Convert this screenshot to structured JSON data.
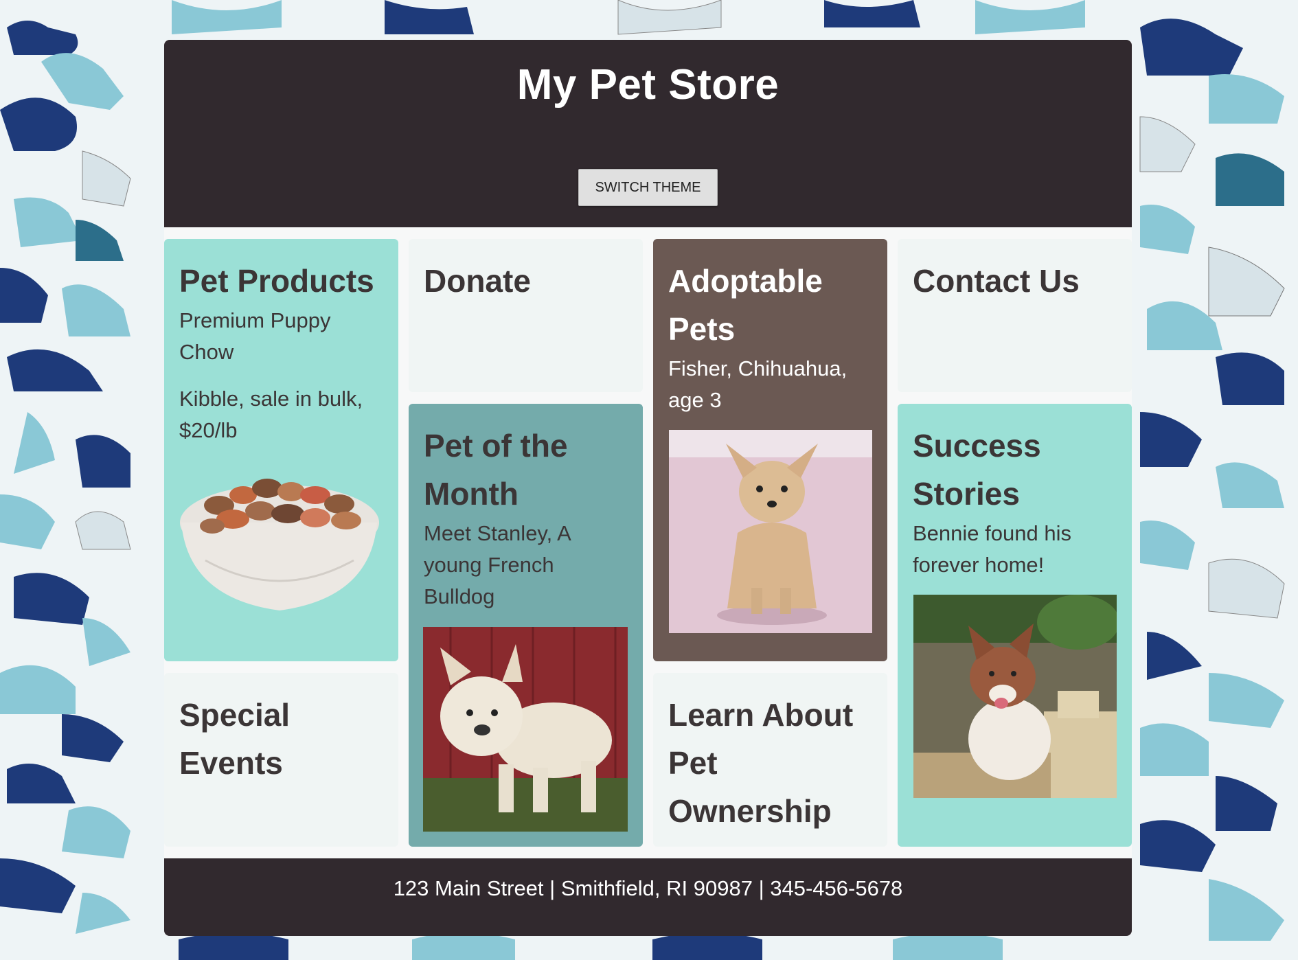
{
  "header": {
    "title": "My Pet Store",
    "theme_button_label": "SWITCH THEME"
  },
  "cards": {
    "pet_products": {
      "title": "Pet Products",
      "item": "Premium Puppy Chow",
      "description": "Kibble, sale in bulk, $20/lb"
    },
    "donate": {
      "title": "Donate"
    },
    "adoptable_pets": {
      "title": "Adoptable Pets",
      "pet": "Fisher, Chihuahua, age 3"
    },
    "contact": {
      "title": "Contact Us"
    },
    "pet_of_month": {
      "title": "Pet of the Month",
      "description": "Meet Stanley, A young French Bulldog"
    },
    "success_stories": {
      "title": "Success Stories",
      "story": "Bennie found his forever home!"
    },
    "special_events": {
      "title": "Special Events"
    },
    "learn": {
      "title": "Learn About Pet Ownership"
    }
  },
  "footer": {
    "address": "123 Main Street | Smithfield, RI 90987 | 345-456-5678"
  },
  "colors": {
    "header_bg": "#31292e",
    "mint": "#9be0d6",
    "teal": "#74abab",
    "brown": "#6b5953",
    "light": "#f0f5f4"
  }
}
